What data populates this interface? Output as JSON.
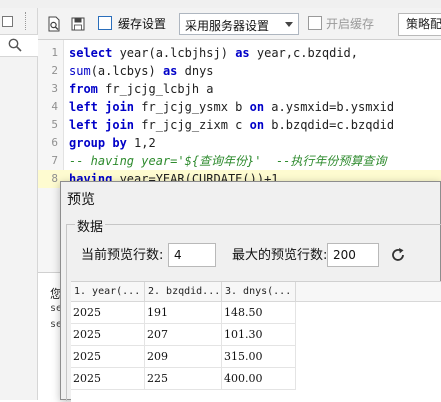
{
  "toolbar": {
    "cache_settings_label": "缓存设置",
    "server_select_value": "采用服务器设置",
    "enable_cache_label": "开启缓存",
    "strategy_button_label": "策略配"
  },
  "editor": {
    "lines": [
      {
        "num": "1",
        "tokens": [
          {
            "t": "select",
            "c": "kw"
          },
          {
            "t": " year(a.lcbjhsj) ",
            "c": "pl"
          },
          {
            "t": "as",
            "c": "kw"
          },
          {
            "t": " year,c.bzqdid,",
            "c": "pl"
          }
        ]
      },
      {
        "num": "2",
        "tokens": [
          {
            "t": "sum",
            "c": "fn"
          },
          {
            "t": "(a.lcbys) ",
            "c": "pl"
          },
          {
            "t": "as",
            "c": "kw"
          },
          {
            "t": " dnys",
            "c": "pl"
          }
        ]
      },
      {
        "num": "3",
        "tokens": [
          {
            "t": "from",
            "c": "kw"
          },
          {
            "t": " fr_jcjg_lcbjh a",
            "c": "pl"
          }
        ]
      },
      {
        "num": "4",
        "tokens": [
          {
            "t": "left join",
            "c": "kw"
          },
          {
            "t": " fr_jcjg_ysmx b ",
            "c": "pl"
          },
          {
            "t": "on",
            "c": "kw"
          },
          {
            "t": " a.ysmxid=b.ysmxid",
            "c": "pl"
          }
        ]
      },
      {
        "num": "5",
        "tokens": [
          {
            "t": "left join",
            "c": "kw"
          },
          {
            "t": " fr_jcjg_zixm c ",
            "c": "pl"
          },
          {
            "t": "on",
            "c": "kw"
          },
          {
            "t": " b.bzqdid=c.bzqdid",
            "c": "pl"
          }
        ]
      },
      {
        "num": "6",
        "tokens": [
          {
            "t": "group by",
            "c": "kw"
          },
          {
            "t": " 1,2",
            "c": "pl"
          }
        ]
      },
      {
        "num": "7",
        "tokens": [
          {
            "t": "-- having year='${查询年份}'  --执行年份预算查询",
            "c": "cm"
          }
        ]
      },
      {
        "num": "8",
        "tokens": [
          {
            "t": "having",
            "c": "kw"
          },
          {
            "t": " year=YEAR(CURDATE())+1",
            "c": "pl"
          }
        ]
      }
    ]
  },
  "log": {
    "line1": "您",
    "line2": "se",
    "line3": "se"
  },
  "dialog": {
    "title": "预览",
    "group_title": "数据",
    "current_rows_label": "当前预览行数:",
    "current_rows_value": "4",
    "max_rows_label": "最大的预览行数:",
    "max_rows_value": "200",
    "columns": [
      "1. year(...",
      "2. bzqdid...",
      "3. dnys(..."
    ],
    "rows": [
      [
        "2025",
        "191",
        "148.50"
      ],
      [
        "2025",
        "207",
        "101.30"
      ],
      [
        "2025",
        "209",
        "315.00"
      ],
      [
        "2025",
        "225",
        "400.00"
      ]
    ]
  }
}
